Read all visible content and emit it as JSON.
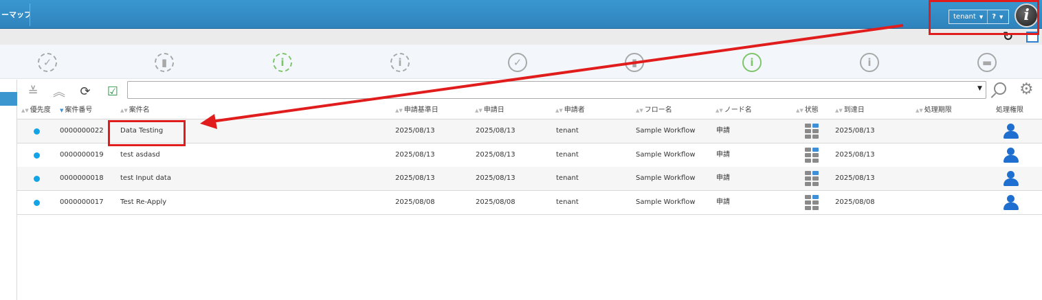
{
  "header": {
    "menu_tab_label": "ーマップ",
    "user_label": "tenant",
    "help_label": "?",
    "logo_glyph": "i"
  },
  "status_icons": [
    "check-dashed-icon",
    "document-dashed-icon",
    "info-dashed-icon",
    "info-dashed-icon",
    "check-circle-icon",
    "document-circle-icon",
    "info-circle-icon",
    "info-circle-icon",
    "folder-circle-icon"
  ],
  "table": {
    "columns": [
      "優先度",
      "案件番号",
      "案件名",
      "申請基準日",
      "申請日",
      "申請者",
      "フロー名",
      "ノード名",
      "状態",
      "到達日",
      "処理期限",
      "処理権限"
    ],
    "rows": [
      {
        "id": "0000000022",
        "name": "Data Testing",
        "base_date": "2025/08/13",
        "apply_date": "2025/08/13",
        "applicant": "tenant",
        "flow": "Sample Workflow",
        "node": "申請",
        "arrival": "2025/08/13",
        "deadline": ""
      },
      {
        "id": "0000000019",
        "name": "test asdasd",
        "base_date": "2025/08/13",
        "apply_date": "2025/08/13",
        "applicant": "tenant",
        "flow": "Sample Workflow",
        "node": "申請",
        "arrival": "2025/08/13",
        "deadline": ""
      },
      {
        "id": "0000000018",
        "name": "test Input data",
        "base_date": "2025/08/13",
        "apply_date": "2025/08/13",
        "applicant": "tenant",
        "flow": "Sample Workflow",
        "node": "申請",
        "arrival": "2025/08/13",
        "deadline": ""
      },
      {
        "id": "0000000017",
        "name": "Test Re-Apply",
        "base_date": "2025/08/08",
        "apply_date": "2025/08/08",
        "applicant": "tenant",
        "flow": "Sample Workflow",
        "node": "申請",
        "arrival": "2025/08/08",
        "deadline": ""
      }
    ]
  },
  "colors": {
    "header_blue": "#3a97cf",
    "priority_dot": "#12a4e6",
    "permission_icon": "#1f6fd0",
    "annotation_red": "#e11c1c",
    "status_green": "#7dc46b"
  }
}
